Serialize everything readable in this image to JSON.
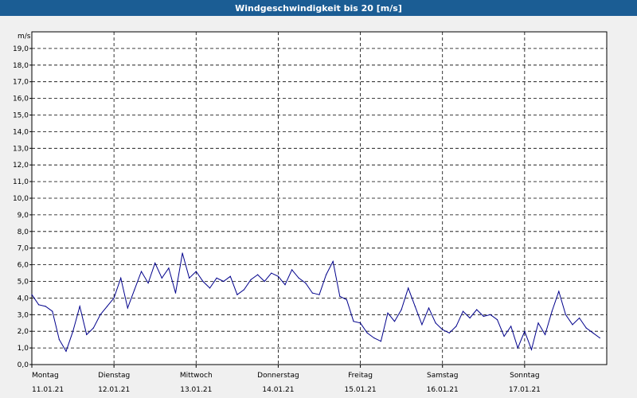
{
  "window": {
    "title": "Windgeschwindigkeit bis 20 [m/s]",
    "accent": "#1b5d94"
  },
  "chart_data": {
    "type": "line",
    "title": "Windgeschwindigkeit bis 20 [m/s]",
    "ylabel": "m/s",
    "ylim": [
      0,
      20
    ],
    "yticks": [
      "0,0",
      "1,0",
      "2,0",
      "3,0",
      "4,0",
      "5,0",
      "6,0",
      "7,0",
      "8,0",
      "9,0",
      "10,0",
      "11,0",
      "12,0",
      "13,0",
      "14,0",
      "15,0",
      "16,0",
      "17,0",
      "18,0",
      "19,0"
    ],
    "xlim": [
      "11.01.21 00:00",
      "17.01.21 24:00"
    ],
    "days": [
      {
        "name": "Montag",
        "date": "11.01.21"
      },
      {
        "name": "Dienstag",
        "date": "12.01.21"
      },
      {
        "name": "Mittwoch",
        "date": "13.01.21"
      },
      {
        "name": "Donnerstag",
        "date": "14.01.21"
      },
      {
        "name": "Freitag",
        "date": "15.01.21"
      },
      {
        "name": "Samstag",
        "date": "16.01.21"
      },
      {
        "name": "Sonntag",
        "date": "17.01.21"
      }
    ],
    "grid": true,
    "line_color": "#00008b",
    "series": [
      {
        "x_unit": "hours from 11.01.21 00:00",
        "x": [
          0,
          2,
          4,
          6,
          8,
          10,
          12,
          14,
          16,
          18,
          20,
          22,
          24,
          26,
          28,
          30,
          32,
          34,
          36,
          38,
          40,
          42,
          44,
          46,
          48,
          50,
          52,
          54,
          56,
          58,
          60,
          62,
          64,
          66,
          68,
          70,
          72,
          74,
          76,
          78,
          80,
          82,
          84,
          86,
          88,
          90,
          92,
          94,
          96,
          98,
          100,
          102,
          104,
          106,
          108,
          110,
          112,
          114,
          116,
          118,
          120,
          122,
          124,
          126,
          128,
          130,
          132,
          134,
          136,
          138,
          140,
          142,
          144,
          146,
          148,
          150,
          152,
          154,
          156,
          158,
          160,
          162,
          164,
          166
        ],
        "values": [
          4.2,
          3.6,
          3.5,
          3.2,
          1.5,
          0.8,
          2.0,
          3.5,
          1.8,
          2.2,
          3.0,
          3.5,
          4.0,
          5.2,
          3.4,
          4.5,
          5.6,
          4.9,
          6.1,
          5.2,
          5.8,
          4.3,
          6.7,
          5.2,
          5.6,
          5.0,
          4.6,
          5.2,
          5.0,
          5.3,
          4.2,
          4.5,
          5.1,
          5.4,
          5.0,
          5.5,
          5.3,
          4.8,
          5.7,
          5.2,
          4.9,
          4.3,
          4.2,
          5.4,
          6.2,
          4.1,
          3.9,
          2.6,
          2.5,
          1.9,
          1.6,
          1.4,
          3.1,
          2.6,
          3.3,
          4.6,
          3.5,
          2.4,
          3.4,
          2.5,
          2.1,
          1.9,
          2.3,
          3.2,
          2.8,
          3.3,
          2.9,
          3.0,
          2.7,
          1.7,
          2.3,
          1.0,
          2.0,
          0.9,
          2.5,
          1.8,
          3.2,
          4.4,
          3.0,
          2.4,
          2.8,
          2.2,
          1.9,
          1.6
        ]
      }
    ]
  }
}
